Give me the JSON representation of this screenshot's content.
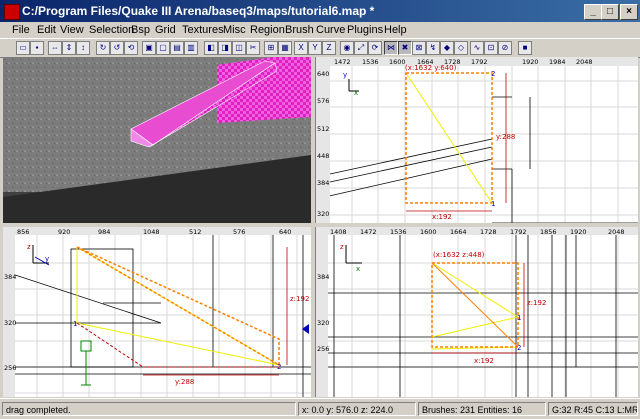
{
  "window": {
    "title": "C:/Program Files/Quake III Arena/baseq3/maps/tutorial6.map *"
  },
  "window_buttons": [
    "_",
    "□",
    "×"
  ],
  "menu": [
    "File",
    "Edit",
    "View",
    "Selection",
    "Bsp",
    "Grid",
    "Textures",
    "Misc",
    "Region",
    "Brush",
    "Curve",
    "Plugins",
    "Help"
  ],
  "toolbar_icons": [
    "open-icon",
    "save-icon",
    "flip-x-icon",
    "flip-y-icon",
    "flip-z-icon",
    "rotate-x-icon",
    "rotate-y-icon",
    "rotate-z-icon",
    "select-complete-tall-icon",
    "select-inside-icon",
    "select-partial-tall-icon",
    "select-touching-icon",
    "csg-subtract-icon",
    "csg-merge-icon",
    "hollow-icon",
    "clipper-icon",
    "change-view-icon",
    "texture-view-icon",
    "view-x-icon",
    "view-y-icon",
    "view-z-icon",
    "camera-icon",
    "scale-icon",
    "rotate-icon",
    "drag-edges-icon",
    "drag-vertices-icon",
    "show-patches-icon",
    "patch-bend-icon",
    "cap-icon",
    "thicken-icon",
    "curve-icon",
    "texture-lock-icon",
    "rotation-lock-icon",
    "region-icon"
  ],
  "colors": {
    "brush_selected": "#e020c0",
    "selection_box": "#ff8000",
    "size_label": "#c00000",
    "grid_major": "#000000",
    "grid_minor": "#c8c8c8",
    "yellow_line": "#f0f000"
  },
  "views": {
    "top_right": {
      "top_ticks": [
        "1472",
        "1536",
        "1600",
        "1664",
        "1728",
        "1792",
        "1920",
        "1984",
        "2048"
      ],
      "left_ticks": [
        "640",
        "576",
        "512",
        "448",
        "384",
        "320"
      ],
      "axis_labels": {
        "vertical": "y",
        "horizontal": "x"
      },
      "coord_label": "(x:1632  y:640)",
      "size_x": "x:192",
      "size_y": "y:288",
      "vertex_labels": [
        "2",
        "1"
      ]
    },
    "bottom_left": {
      "top_ticks": [
        "856",
        "920",
        "984",
        "1048",
        "512",
        "576",
        "640"
      ],
      "left_ticks": [
        "384",
        "320",
        "256"
      ],
      "axis_labels": {
        "vertical": "z",
        "horizontal": "y"
      },
      "size_z": "z:192",
      "size_y": "y:288",
      "vertex_labels": [
        "1",
        "2"
      ]
    },
    "bottom_right": {
      "top_ticks": [
        "1408",
        "1472",
        "1536",
        "1600",
        "1664",
        "1728",
        "1792",
        "1856",
        "1920",
        "2048"
      ],
      "left_ticks": [
        "384",
        "320",
        "256"
      ],
      "axis_labels": {
        "vertical": "z",
        "horizontal": "x"
      },
      "coord_label": "(x:1632  z:448)",
      "size_z": "z:192",
      "size_x": "x:192",
      "vertex_labels": [
        "1",
        "2"
      ]
    }
  },
  "status": {
    "message": "drag completed.",
    "coords": "x:  0.0  y:  576.0  z:  224.0",
    "counts": "Brushes: 231  Entities: 16",
    "info": "G:32 R:45 C:13 L:MR"
  }
}
